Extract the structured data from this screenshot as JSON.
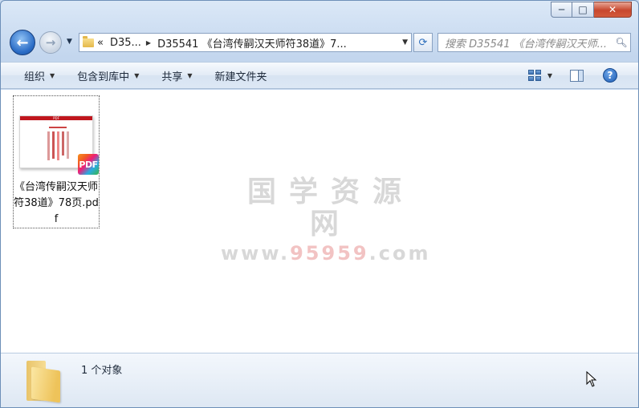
{
  "window": {
    "caption_buttons": {
      "minimize": "─",
      "maximize": "□",
      "close": "✕"
    }
  },
  "nav": {
    "back_glyph": "←",
    "forward_glyph": "→",
    "address": {
      "overflow": "«",
      "segments": [
        "D35...",
        "D35541 《台湾传嗣汉天师符38道》7..."
      ]
    },
    "refresh_glyph": "⟳",
    "search_placeholder": "搜索 D35541 《台湾传嗣汉天师...",
    "search_icon": "magnifier-icon"
  },
  "toolbar": {
    "items": [
      "组织",
      "包含到库中",
      "共享",
      "新建文件夹"
    ],
    "help_glyph": "?"
  },
  "files": [
    {
      "name": "《台湾传嗣汉天师符38道》78页.pdf",
      "badge": "PDF",
      "thumb_header": "PDF"
    }
  ],
  "watermark": {
    "title": "国学资源网",
    "url_prefix": "www.",
    "url_highlight": "95959",
    "url_suffix": ".com"
  },
  "details": {
    "count_label": "1 个对象"
  },
  "colors": {
    "accent_blue": "#2a6cc6",
    "close_red": "#c7472d",
    "pdf_red": "#c0161d"
  }
}
